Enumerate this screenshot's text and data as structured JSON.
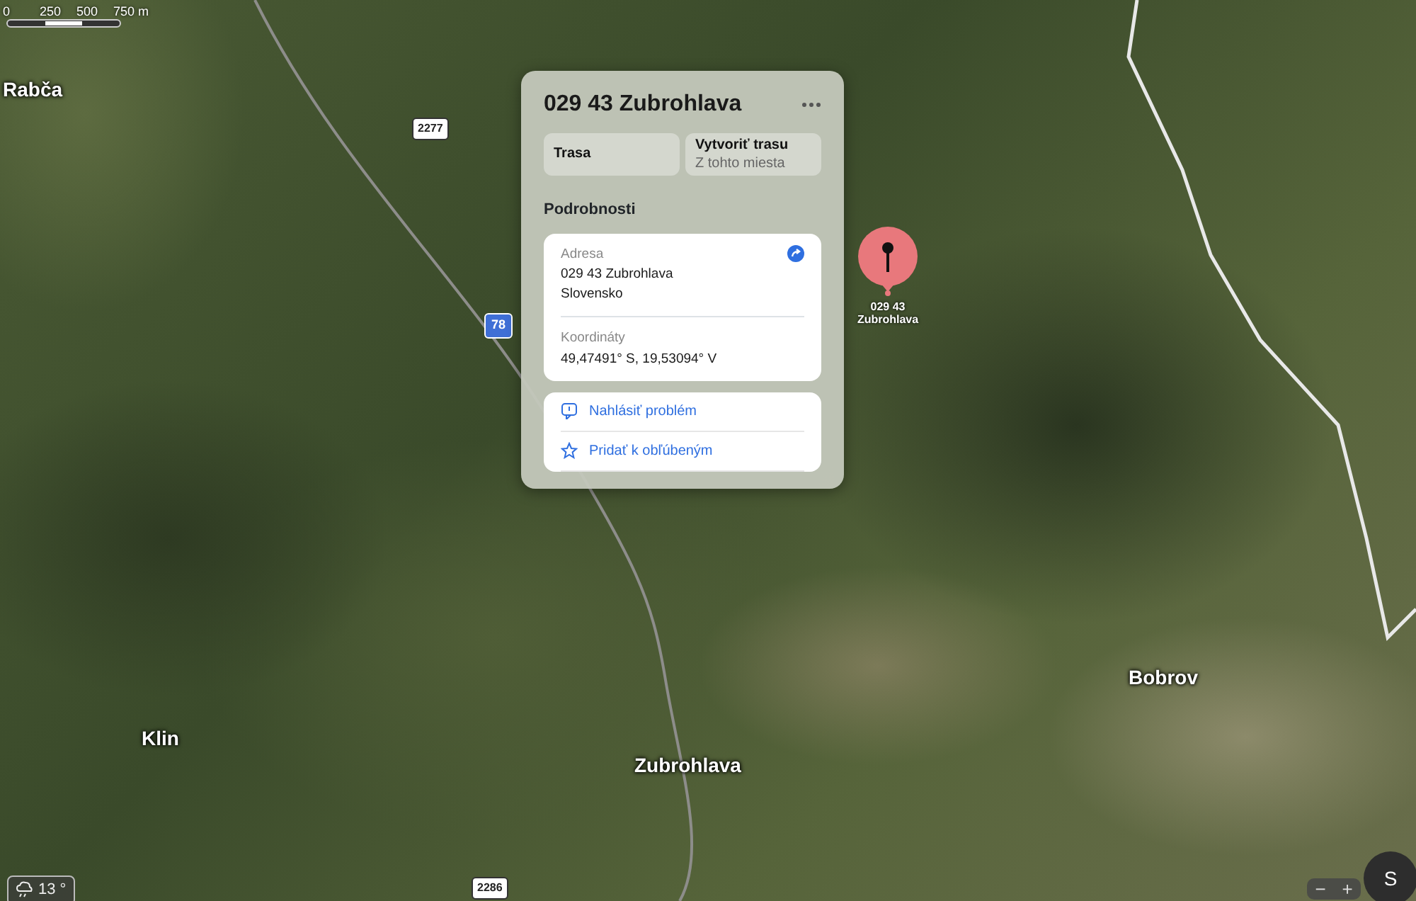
{
  "scale_bar": {
    "ticks": [
      "0",
      "250",
      "500",
      "750 m"
    ]
  },
  "map_labels": [
    {
      "text": "Rabča",
      "kind": "place"
    },
    {
      "text": "2277",
      "kind": "road"
    },
    {
      "text": "78",
      "kind": "highway"
    },
    {
      "text": "Klin",
      "kind": "place"
    },
    {
      "text": "Zubrohlava",
      "kind": "place"
    },
    {
      "text": "Bobrov",
      "kind": "place"
    },
    {
      "text": "2286",
      "kind": "road"
    }
  ],
  "place_card": {
    "title": "029 43 Zubrohlava",
    "actions": [
      {
        "label": "Trasa"
      },
      {
        "label": "Vytvoriť trasu",
        "sublabel": "Z tohto miesta"
      }
    ],
    "section_title": "Podrobnosti",
    "details": [
      {
        "label": "Adresa",
        "lines": [
          "029 43 Zubrohlava",
          "Slovensko"
        ],
        "kind": "address"
      },
      {
        "label": "Koordináty",
        "lines": [
          "49,47491° S, 19,53094° V"
        ],
        "kind": "plain"
      }
    ],
    "links": [
      {
        "label": "Nahlásiť problém",
        "kind": "report"
      },
      {
        "label": "Pridať k obľúbeným",
        "kind": "favorite"
      }
    ]
  },
  "pin": {
    "lines": [
      "029 43",
      "Zubrohlava"
    ]
  },
  "weather": {
    "temperature": "13 °"
  },
  "zoom_controls": {
    "out": "−",
    "in": "+"
  },
  "compass": {
    "heading": "S"
  }
}
